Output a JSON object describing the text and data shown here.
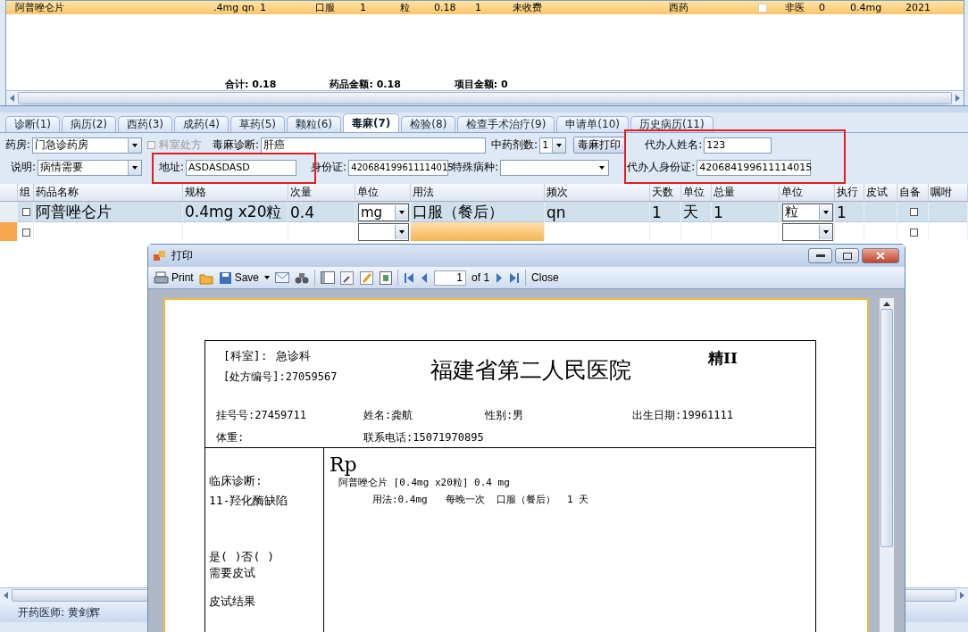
{
  "result_grid": {
    "row": {
      "cells": [
        "阿普唑仑片",
        ".4mg qn",
        "1",
        "口服",
        "1",
        "粒",
        "0.18",
        "1",
        "未收费",
        "西药"
      ],
      "checked": false,
      "cells_after": [
        "非医",
        "0",
        "0.4mg",
        "2021"
      ]
    },
    "totals": [
      {
        "label": "合计:",
        "value": "0.18"
      },
      {
        "label": "药品金额:",
        "value": "0.18"
      },
      {
        "label": "项目金额:",
        "value": "0"
      }
    ]
  },
  "tabs": [
    {
      "label": "诊断(1)",
      "selected": false
    },
    {
      "label": "病历(2)",
      "selected": false
    },
    {
      "label": "西药(3)",
      "selected": false
    },
    {
      "label": "成药(4)",
      "selected": false
    },
    {
      "label": "草药(5)",
      "selected": false
    },
    {
      "label": "颗粒(6)",
      "selected": false
    },
    {
      "label": "毒麻(7)",
      "selected": true
    },
    {
      "label": "检验(8)",
      "selected": false
    },
    {
      "label": "检查手术治疗(9)",
      "selected": false
    },
    {
      "label": "申请单(10)",
      "selected": false
    },
    {
      "label": "历史病历(11)",
      "selected": false
    }
  ],
  "form": {
    "pharmacy": {
      "label": "药房:",
      "value": "门急诊药房"
    },
    "dept_prescription": {
      "label": "科室处方",
      "checked": false,
      "disabled": true
    },
    "diagnosis": {
      "label": "毒麻诊断:",
      "value": "肝癌"
    },
    "herb_doses": {
      "label": "中药剂数:",
      "value": "1"
    },
    "print_button": "毒麻打印",
    "agent_name": {
      "label": "代办人姓名:",
      "value": "123"
    },
    "note": {
      "label": "说明:",
      "value": "病情需要"
    },
    "address": {
      "label": "地址:",
      "value": "ASDASDASD"
    },
    "id_card": {
      "label": "身份证:",
      "value": "420684199611114015"
    },
    "special_disease": {
      "label": "特殊病种:"
    },
    "agent_id": {
      "label": "代办人身份证:",
      "value": "420684199611114015"
    }
  },
  "drug_table": {
    "columns": [
      "组",
      "药品名称",
      "规格",
      "次量",
      "单位",
      "用法",
      "频次",
      "天数",
      "单位",
      "总量",
      "单位",
      "执行",
      "皮试",
      "自备",
      "嘱咐"
    ],
    "rows": [
      {
        "group_checked": false,
        "name": "阿普唑仑片",
        "spec": "0.4mg x20粒",
        "dose": "0.4",
        "dose_unit": "mg",
        "usage": "口服（餐后）",
        "frequency": "qn",
        "days": "1",
        "day_unit": "天",
        "total": "1",
        "total_unit": "粒",
        "execute": "1",
        "self_supplied": false
      },
      {
        "group_checked": false,
        "name": "",
        "spec": "",
        "dose": "",
        "dose_unit": "",
        "usage": "",
        "frequency": "",
        "days": "",
        "day_unit": "",
        "total": "",
        "total_unit": "",
        "execute": "",
        "self_supplied": false
      }
    ]
  },
  "status_bar": {
    "doctor": "开药医师: 黄剑辉"
  },
  "print_dialog": {
    "title": "打印",
    "toolbar": {
      "print": "Print",
      "save": "Save",
      "page": "1",
      "page_of": "of 1",
      "close": "Close"
    },
    "document": {
      "dept_label": "[科室]:",
      "dept": "急诊科",
      "rx_no": "[处方编号]:27059567",
      "hospital": "福建省第二人民医院",
      "category": "精II",
      "patient": [
        "挂号号:27459711",
        "姓名:龚航",
        "性别:男",
        "出生日期:19961111",
        "体重:",
        "联系电话:15071970895"
      ],
      "diagnosis_label": "临床诊断:",
      "diagnosis": "11-羟化酶缺陷",
      "skin_test_choice": "是( )否( )",
      "skin_test_needed": "需要皮试",
      "skin_test_result": "皮试结果",
      "rp": "Rp",
      "drug_line": "阿普唑仑片 [0.4mg x20粒] 0.4 mg",
      "usage_line": "用法:0.4mg   每晚一次  口服（餐后）  1 天"
    }
  }
}
